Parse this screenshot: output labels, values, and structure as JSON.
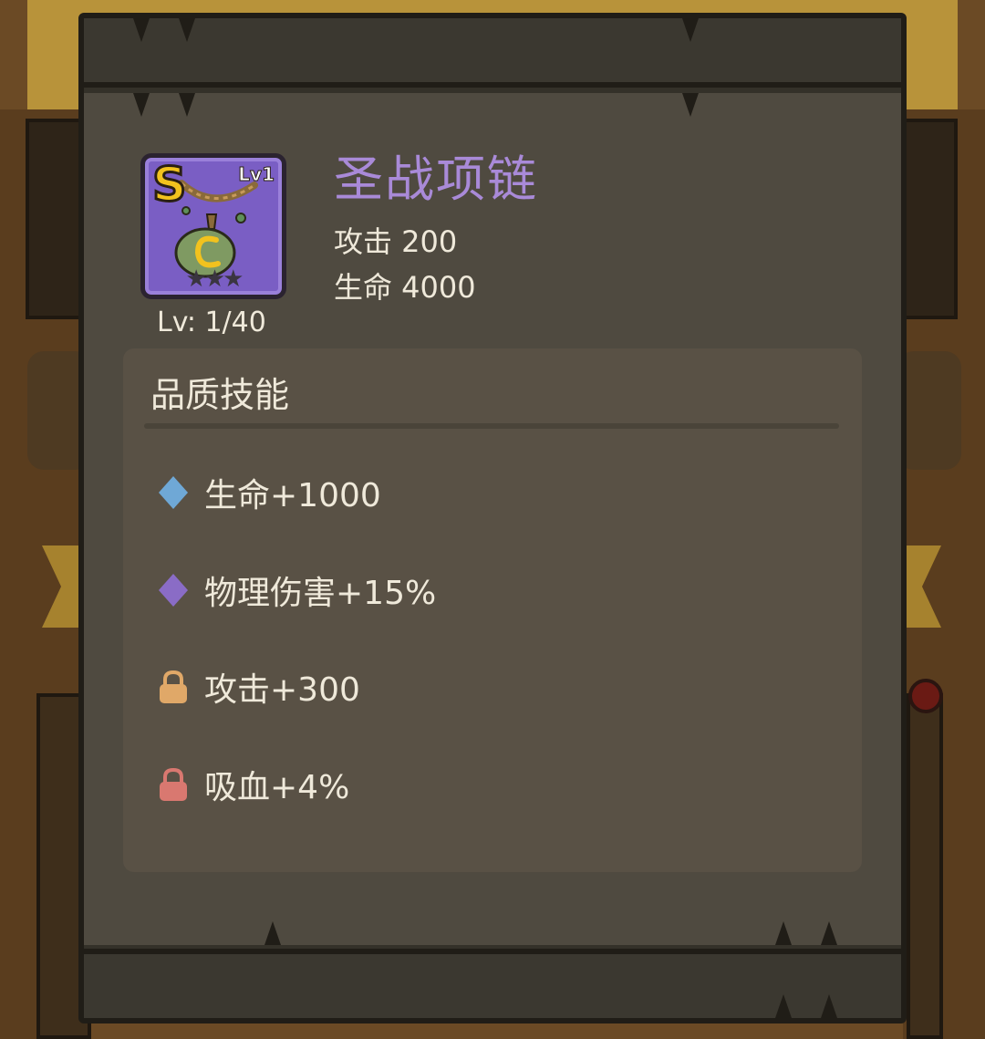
{
  "item": {
    "grade": "S",
    "badge_level": "Lv1",
    "stars": "★★★",
    "level_text": "Lv: 1/40",
    "name": "圣战项链",
    "name_color": "#a98ad8",
    "icon_bg_color": "#7a5ec4"
  },
  "stats": [
    {
      "text": "攻击 200"
    },
    {
      "text": "生命 4000"
    }
  ],
  "quality_skills": {
    "title": "品质技能",
    "items": [
      {
        "text": "生命+1000",
        "icon": "diamond-icon",
        "color": "#6fa8d6",
        "locked": false
      },
      {
        "text": "物理伤害+15%",
        "icon": "diamond-icon",
        "color": "#8a6cc6",
        "locked": false
      },
      {
        "text": "攻击+300",
        "icon": "lock-icon",
        "color": "#e0a868",
        "locked": true
      },
      {
        "text": "吸血+4%",
        "icon": "lock-icon",
        "color": "#d97870",
        "locked": true
      }
    ]
  }
}
